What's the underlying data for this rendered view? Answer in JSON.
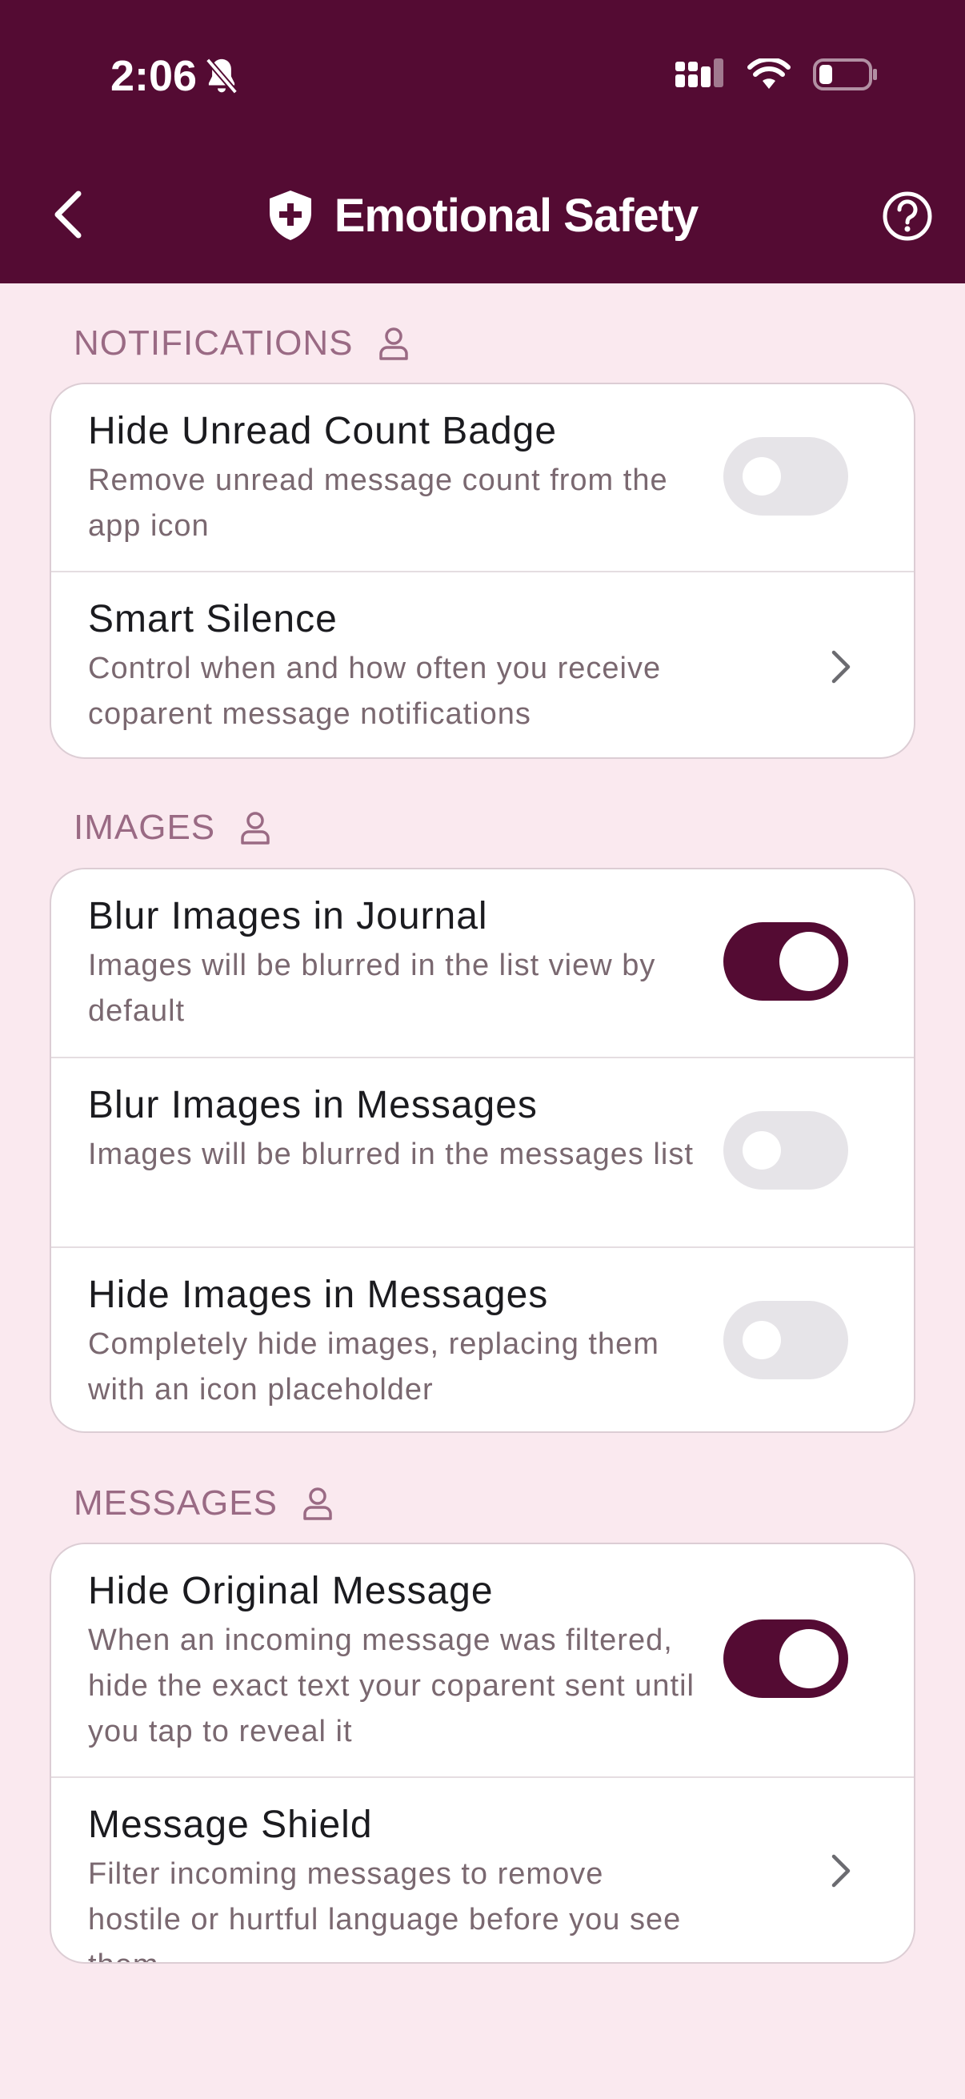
{
  "status_bar": {
    "time": "2:06",
    "silent_icon": "bell-slash-icon",
    "signal_icon": "cellular-signal-icon",
    "wifi_icon": "wifi-icon",
    "battery_icon": "battery-low-icon"
  },
  "nav": {
    "back_icon": "chevron-left-icon",
    "title_icon": "shield-plus-icon",
    "title": "Emotional Safety",
    "help_icon": "question-circle-icon"
  },
  "colors": {
    "brand": "#540B33",
    "background": "#FAE9EF",
    "section_label": "#9A6A84",
    "toggle_off": "#E6E4E8"
  },
  "sections": [
    {
      "label": "NOTIFICATIONS",
      "icon": "person-icon",
      "rows": [
        {
          "title": "Hide Unread Count Badge",
          "desc": "Remove unread message count from the app icon",
          "control": "toggle",
          "on": false
        },
        {
          "title": "Smart Silence",
          "desc": "Control when and how often you receive coparent message notifications",
          "control": "chevron"
        }
      ]
    },
    {
      "label": "IMAGES",
      "icon": "person-icon",
      "rows": [
        {
          "title": "Blur Images in Journal",
          "desc": "Images will be blurred in the list view by default",
          "control": "toggle",
          "on": true
        },
        {
          "title": "Blur Images in Messages",
          "desc": "Images will be blurred in the messages list",
          "control": "toggle",
          "on": false
        },
        {
          "title": "Hide Images in Messages",
          "desc": "Completely hide images, replacing them with an icon placeholder",
          "control": "toggle",
          "on": false
        }
      ]
    },
    {
      "label": "MESSAGES",
      "icon": "person-icon",
      "rows": [
        {
          "title": "Hide Original Message",
          "desc": "When an incoming message was filtered, hide the exact text your coparent sent until you tap to reveal it",
          "control": "toggle",
          "on": true
        },
        {
          "title": "Message Shield",
          "desc": "Filter incoming messages to remove hostile or hurtful language before you see them",
          "control": "chevron"
        }
      ]
    }
  ]
}
